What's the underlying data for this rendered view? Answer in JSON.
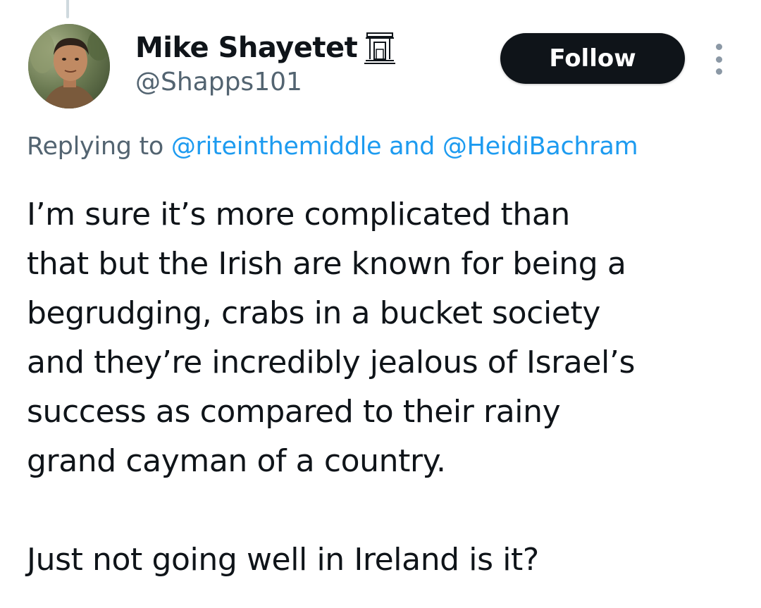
{
  "author": {
    "display_name": "Mike Shayetet",
    "handle": "@Shapps101",
    "avatar_icon": "profile-photo",
    "badge_icon": "pillar-gate-icon"
  },
  "actions": {
    "follow_label": "Follow",
    "more_icon": "more-vertical-icon"
  },
  "reply": {
    "prefix": "Replying to ",
    "mention_1": "@riteinthemiddle",
    "joiner": " and ",
    "mention_2": "@HeidiBachram"
  },
  "tweet": {
    "lines": [
      "I’m sure it’s more complicated than",
      "that but the Irish are known for being a",
      "begrudging, crabs in a bucket society",
      "and they’re incredibly jealous of Israel’s",
      "success as compared to their rainy",
      "grand cayman of a country."
    ],
    "closing_line": "Just not going well in Ireland is it?"
  },
  "colors": {
    "text_primary": "#0f1419",
    "text_secondary": "#536471",
    "link": "#1d9bf0",
    "button_bg": "#0f1419",
    "thread_line": "#cfd9de"
  }
}
